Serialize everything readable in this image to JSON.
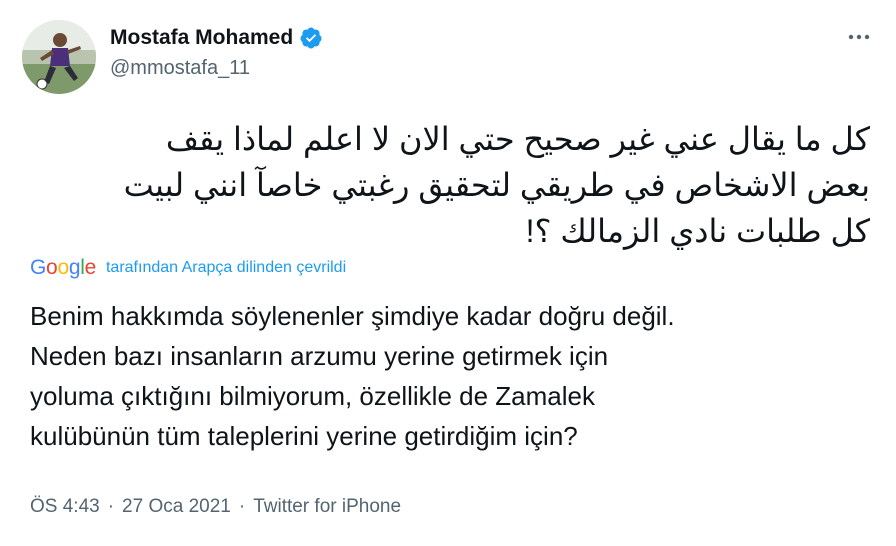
{
  "author": {
    "display_name": "Mostafa Mohamed",
    "handle": "@mmostafa_11",
    "verified": true,
    "avatar_icon": "player-photo-avatar"
  },
  "more_icon": "more-horizontal-icon",
  "tweet": {
    "original_text": "كل ما يقال عني غير صحيح  حتي الان لا اعلم لماذا يقف\nبعض الاشخاص في طريقي لتحقيق رغبتي خاصآ انني لبيت\nكل طلبات نادي الزمالك ؟!",
    "translation_label": "tarafından Arapça dilinden çevrildi",
    "translation_provider": "Google",
    "translated_text": "Benim hakkımda söylenenler şimdiye kadar doğru değil.\nNeden bazı insanların arzumu yerine getirmek için\nyoluma çıktığını bilmiyorum, özellikle de Zamalek\nkulübünün tüm taleplerini yerine getirdiğim için?"
  },
  "meta": {
    "time": "ÖS 4:43",
    "separator": "·",
    "date": "27 Oca 2021",
    "source": "Twitter for iPhone"
  },
  "colors": {
    "text": "#0f1419",
    "secondary": "#536471",
    "link": "#1d9bf0",
    "verified": "#1d9bf0"
  }
}
